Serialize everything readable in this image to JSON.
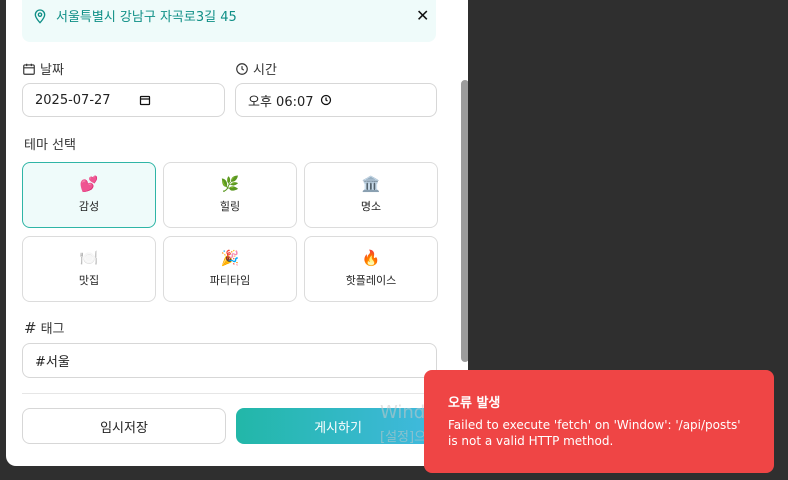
{
  "location": {
    "text": "서울특별시 강남구 자곡로3길 45",
    "close_glyph": "✕"
  },
  "date": {
    "label": "날짜",
    "value": "2025-07-27"
  },
  "time": {
    "label": "시간",
    "value": "오후 06:07"
  },
  "theme": {
    "label": "테마 선택",
    "items": [
      {
        "emoji": "💕",
        "name": "감성",
        "selected": true
      },
      {
        "emoji": "🌿",
        "name": "힐링",
        "selected": false
      },
      {
        "emoji": "🏛️",
        "name": "명소",
        "selected": false
      },
      {
        "emoji": "🍽️",
        "name": "맛집",
        "selected": false
      },
      {
        "emoji": "🎉",
        "name": "파티타임",
        "selected": false
      },
      {
        "emoji": "🔥",
        "name": "핫플레이스",
        "selected": false
      }
    ]
  },
  "tags": {
    "label": "태그",
    "hash_glyph": "#",
    "value": "#서울"
  },
  "buttons": {
    "draft": "임시저장",
    "post": "게시하기"
  },
  "toast": {
    "title": "오류 발생",
    "message": "Failed to execute 'fetch' on 'Window': '/api/posts' is not a valid HTTP method."
  },
  "watermark": {
    "line1": "Windows 정품 인증",
    "line2": "[설정]으로 이동하여 Windows를 정품 인증합니다."
  },
  "colors": {
    "accent": "#2fb5a6",
    "toast_bg": "#ef4545"
  }
}
